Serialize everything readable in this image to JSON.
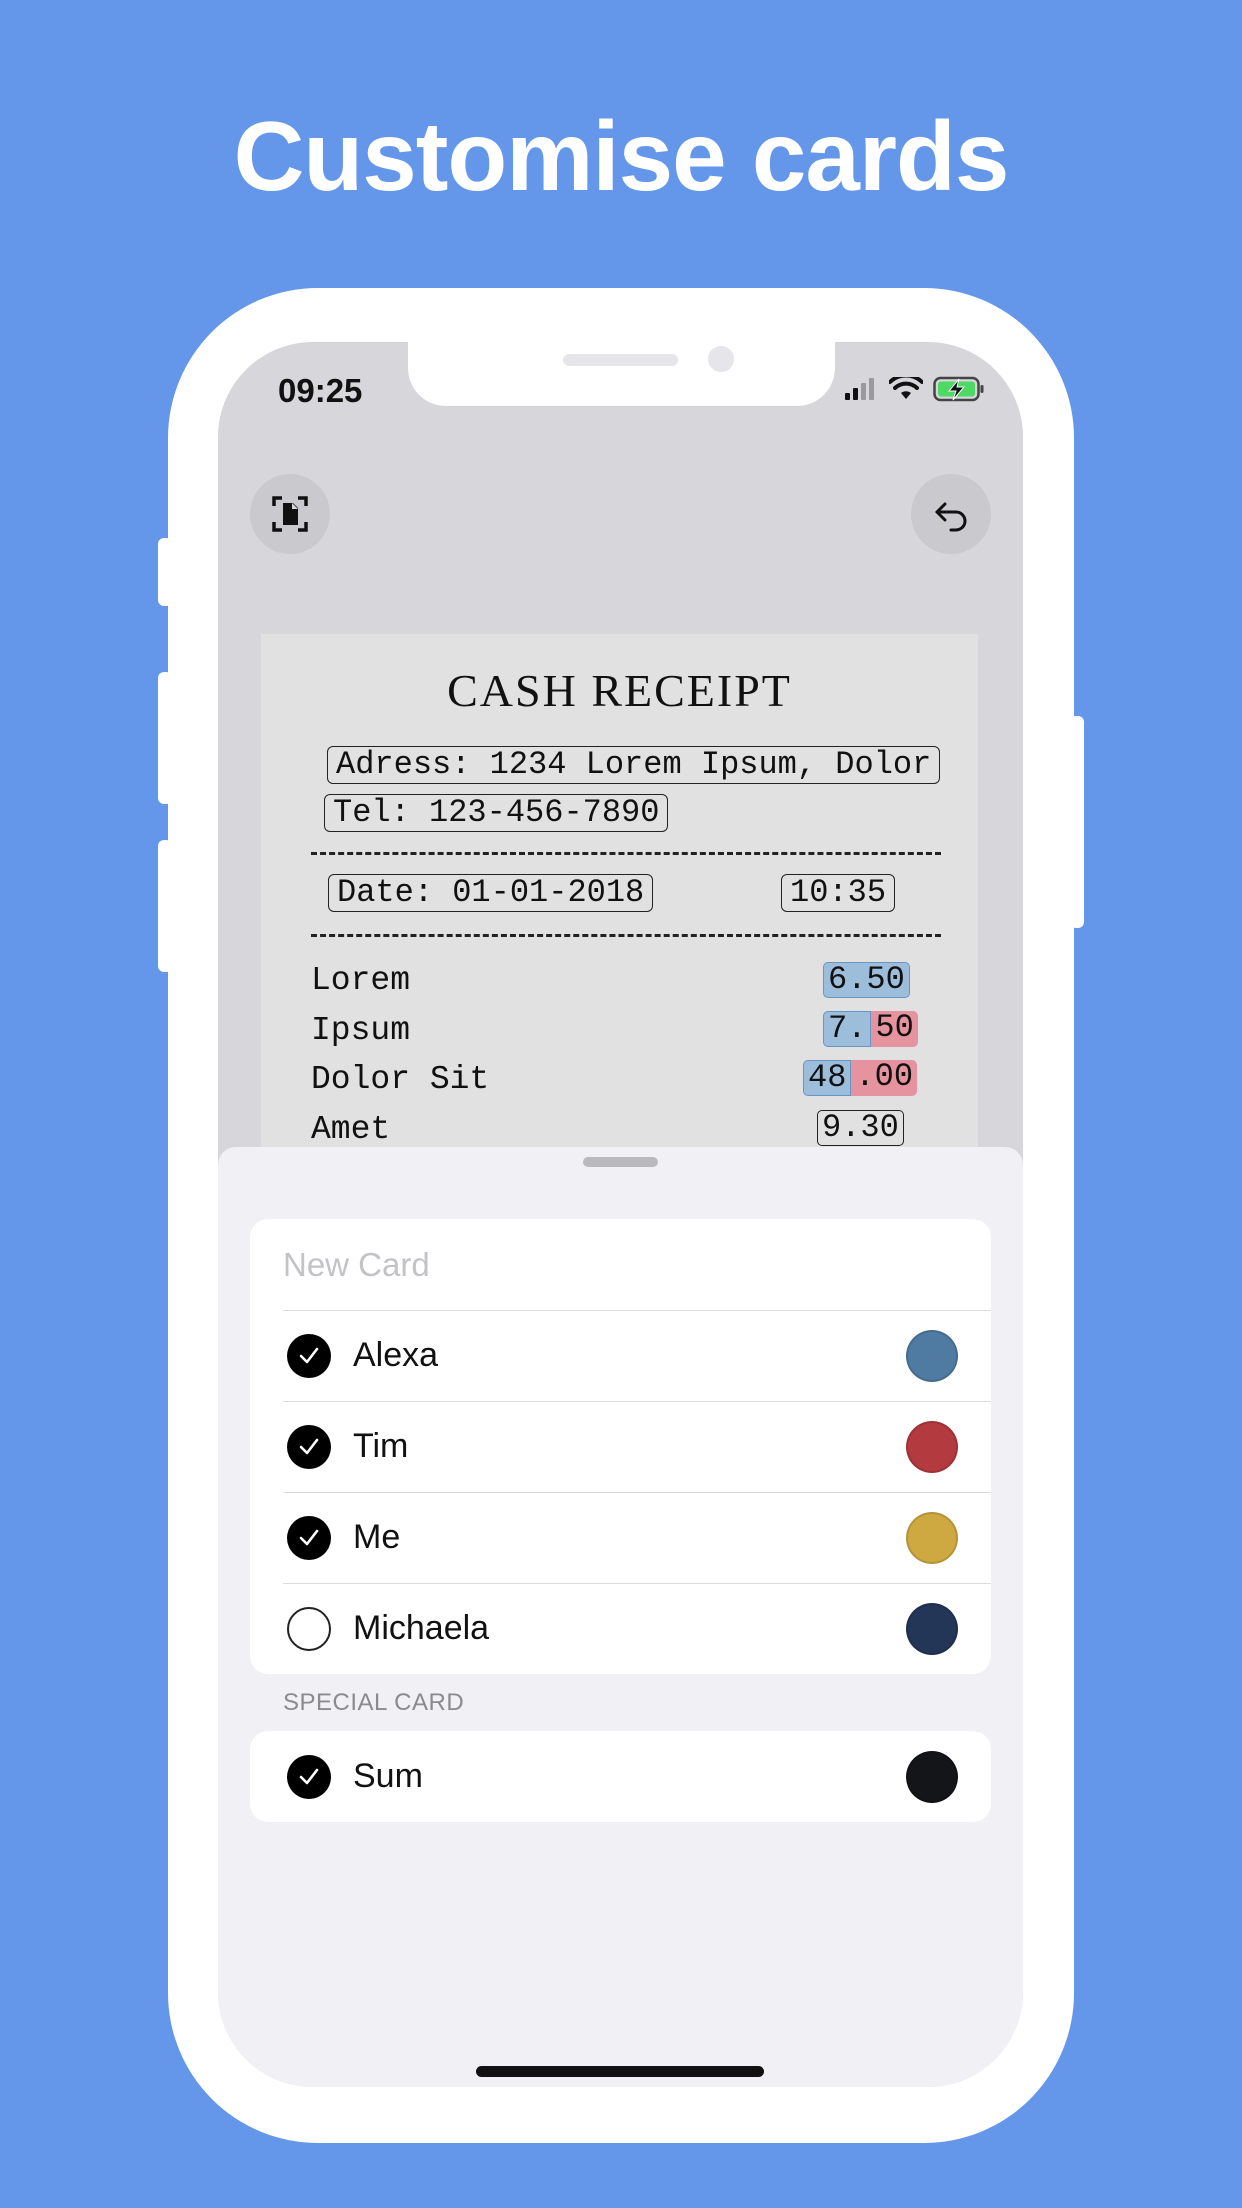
{
  "headline": "Customise cards",
  "status": {
    "time": "09:25"
  },
  "toolbar": {
    "scan_icon": "document-scan-icon",
    "undo_icon": "undo-icon"
  },
  "receipt": {
    "title": "CASH RECEIPT",
    "address": "Adress: 1234 Lorem Ipsum, Dolor",
    "tel": "Tel: 123-456-7890",
    "date": "Date: 01-01-2018",
    "time": "10:35",
    "items": [
      {
        "name": "Lorem",
        "amount": "6.50"
      },
      {
        "name": "Ipsum",
        "amount_a": "7.",
        "amount_b": "50"
      },
      {
        "name": "Dolor Sit",
        "amount_a": "48",
        "amount_b": ".00"
      },
      {
        "name": "Amet",
        "amount": "9.30"
      }
    ]
  },
  "cards": {
    "new_card_placeholder": "New Card",
    "list": [
      {
        "name": "Alexa",
        "checked": true,
        "color": "#4f7ba2"
      },
      {
        "name": "Tim",
        "checked": true,
        "color": "#b33a3f"
      },
      {
        "name": "Me",
        "checked": true,
        "color": "#cea840"
      },
      {
        "name": "Michaela",
        "checked": false,
        "color": "#233658"
      }
    ]
  },
  "special": {
    "header": "SPECIAL CARD",
    "item": {
      "name": "Sum",
      "checked": true,
      "color": "#141519"
    }
  }
}
